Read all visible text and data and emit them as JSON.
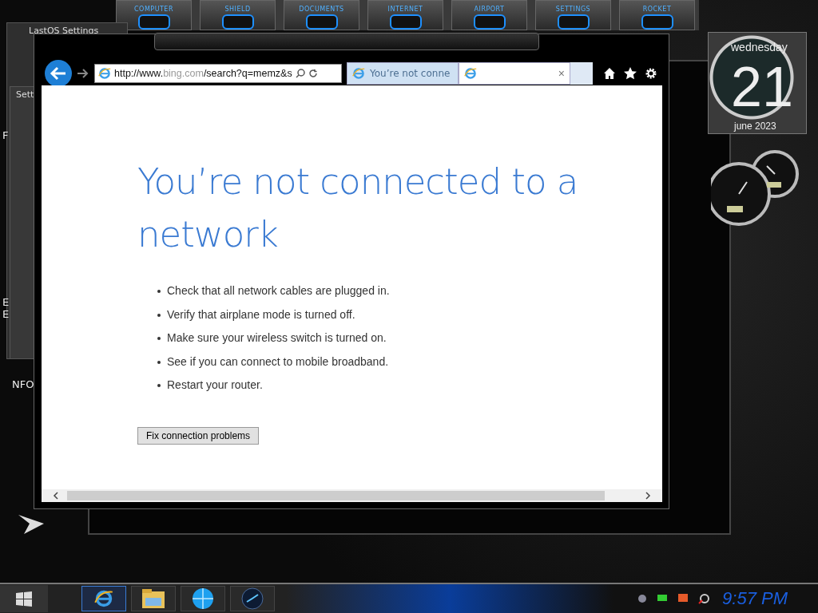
{
  "dock": {
    "items": [
      {
        "label": "COMPUTER"
      },
      {
        "label": "SHIELD"
      },
      {
        "label": "DOCUMENTS"
      },
      {
        "label": "INTERNET"
      },
      {
        "label": "AIRPORT"
      },
      {
        "label": "SETTINGS"
      },
      {
        "label": "ROCKET"
      }
    ]
  },
  "background_windows": [
    {
      "title": "LastOS Settings"
    },
    {
      "title": "Sett"
    }
  ],
  "desktop_labels": [
    "F",
    "E",
    "E",
    "NFO"
  ],
  "browser": {
    "address": {
      "prefix": "http://www.",
      "domain": "bing.com",
      "path": "/search?q=memz&s"
    },
    "tabs": [
      {
        "title": "You’re not conne",
        "selected": false
      },
      {
        "selected": true,
        "close": "×"
      }
    ],
    "page": {
      "heading": "You’re not connected to a network",
      "tips": [
        "Check that all network cables are plugged in.",
        "Verify that airplane mode is turned off.",
        "Make sure your wireless switch is turned on.",
        "See if you can connect to mobile broadband.",
        "Restart your router."
      ],
      "button": "Fix connection problems"
    }
  },
  "clock_gadget": {
    "weekday": "wednesday",
    "day": "21",
    "month_year": "june 2023"
  },
  "taskbar": {
    "apps": [
      {
        "kind": "ie",
        "selected": true
      },
      {
        "kind": "folder",
        "selected": false
      },
      {
        "kind": "globe",
        "selected": false
      },
      {
        "kind": "orb",
        "selected": false
      }
    ],
    "time": "9:57 PM"
  }
}
